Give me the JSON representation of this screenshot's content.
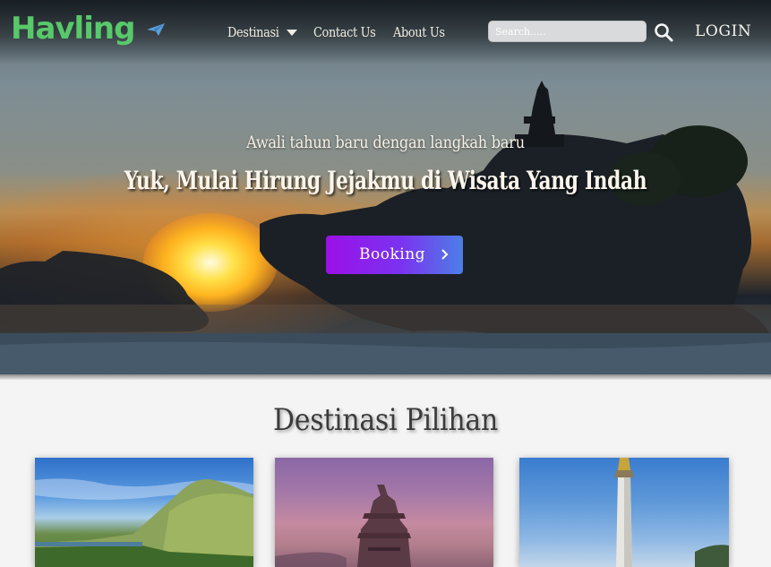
{
  "brand": {
    "logo_text": "Havling"
  },
  "nav": {
    "items": [
      {
        "label": "Destinasi"
      },
      {
        "label": "Contact Us"
      },
      {
        "label": "About Us"
      }
    ],
    "search_placeholder": "Search.....",
    "login_label": "LOGIN"
  },
  "hero": {
    "subtitle": "Awali  tahun baru dengan langkah baru",
    "title": "Yuk, Mulai  Hirung Jejakmu di Wisata Yang Indah",
    "cta_label": "Booking"
  },
  "section": {
    "title": "Destinasi Pilihan"
  },
  "colors": {
    "logo_green": "#4bc96f",
    "cta_gradient_start": "#9b10e8",
    "cta_gradient_end": "#4c7fe6"
  },
  "icons": [
    "caret-down-icon",
    "search-icon",
    "chevron-right-icon",
    "paper-plane-icon"
  ]
}
